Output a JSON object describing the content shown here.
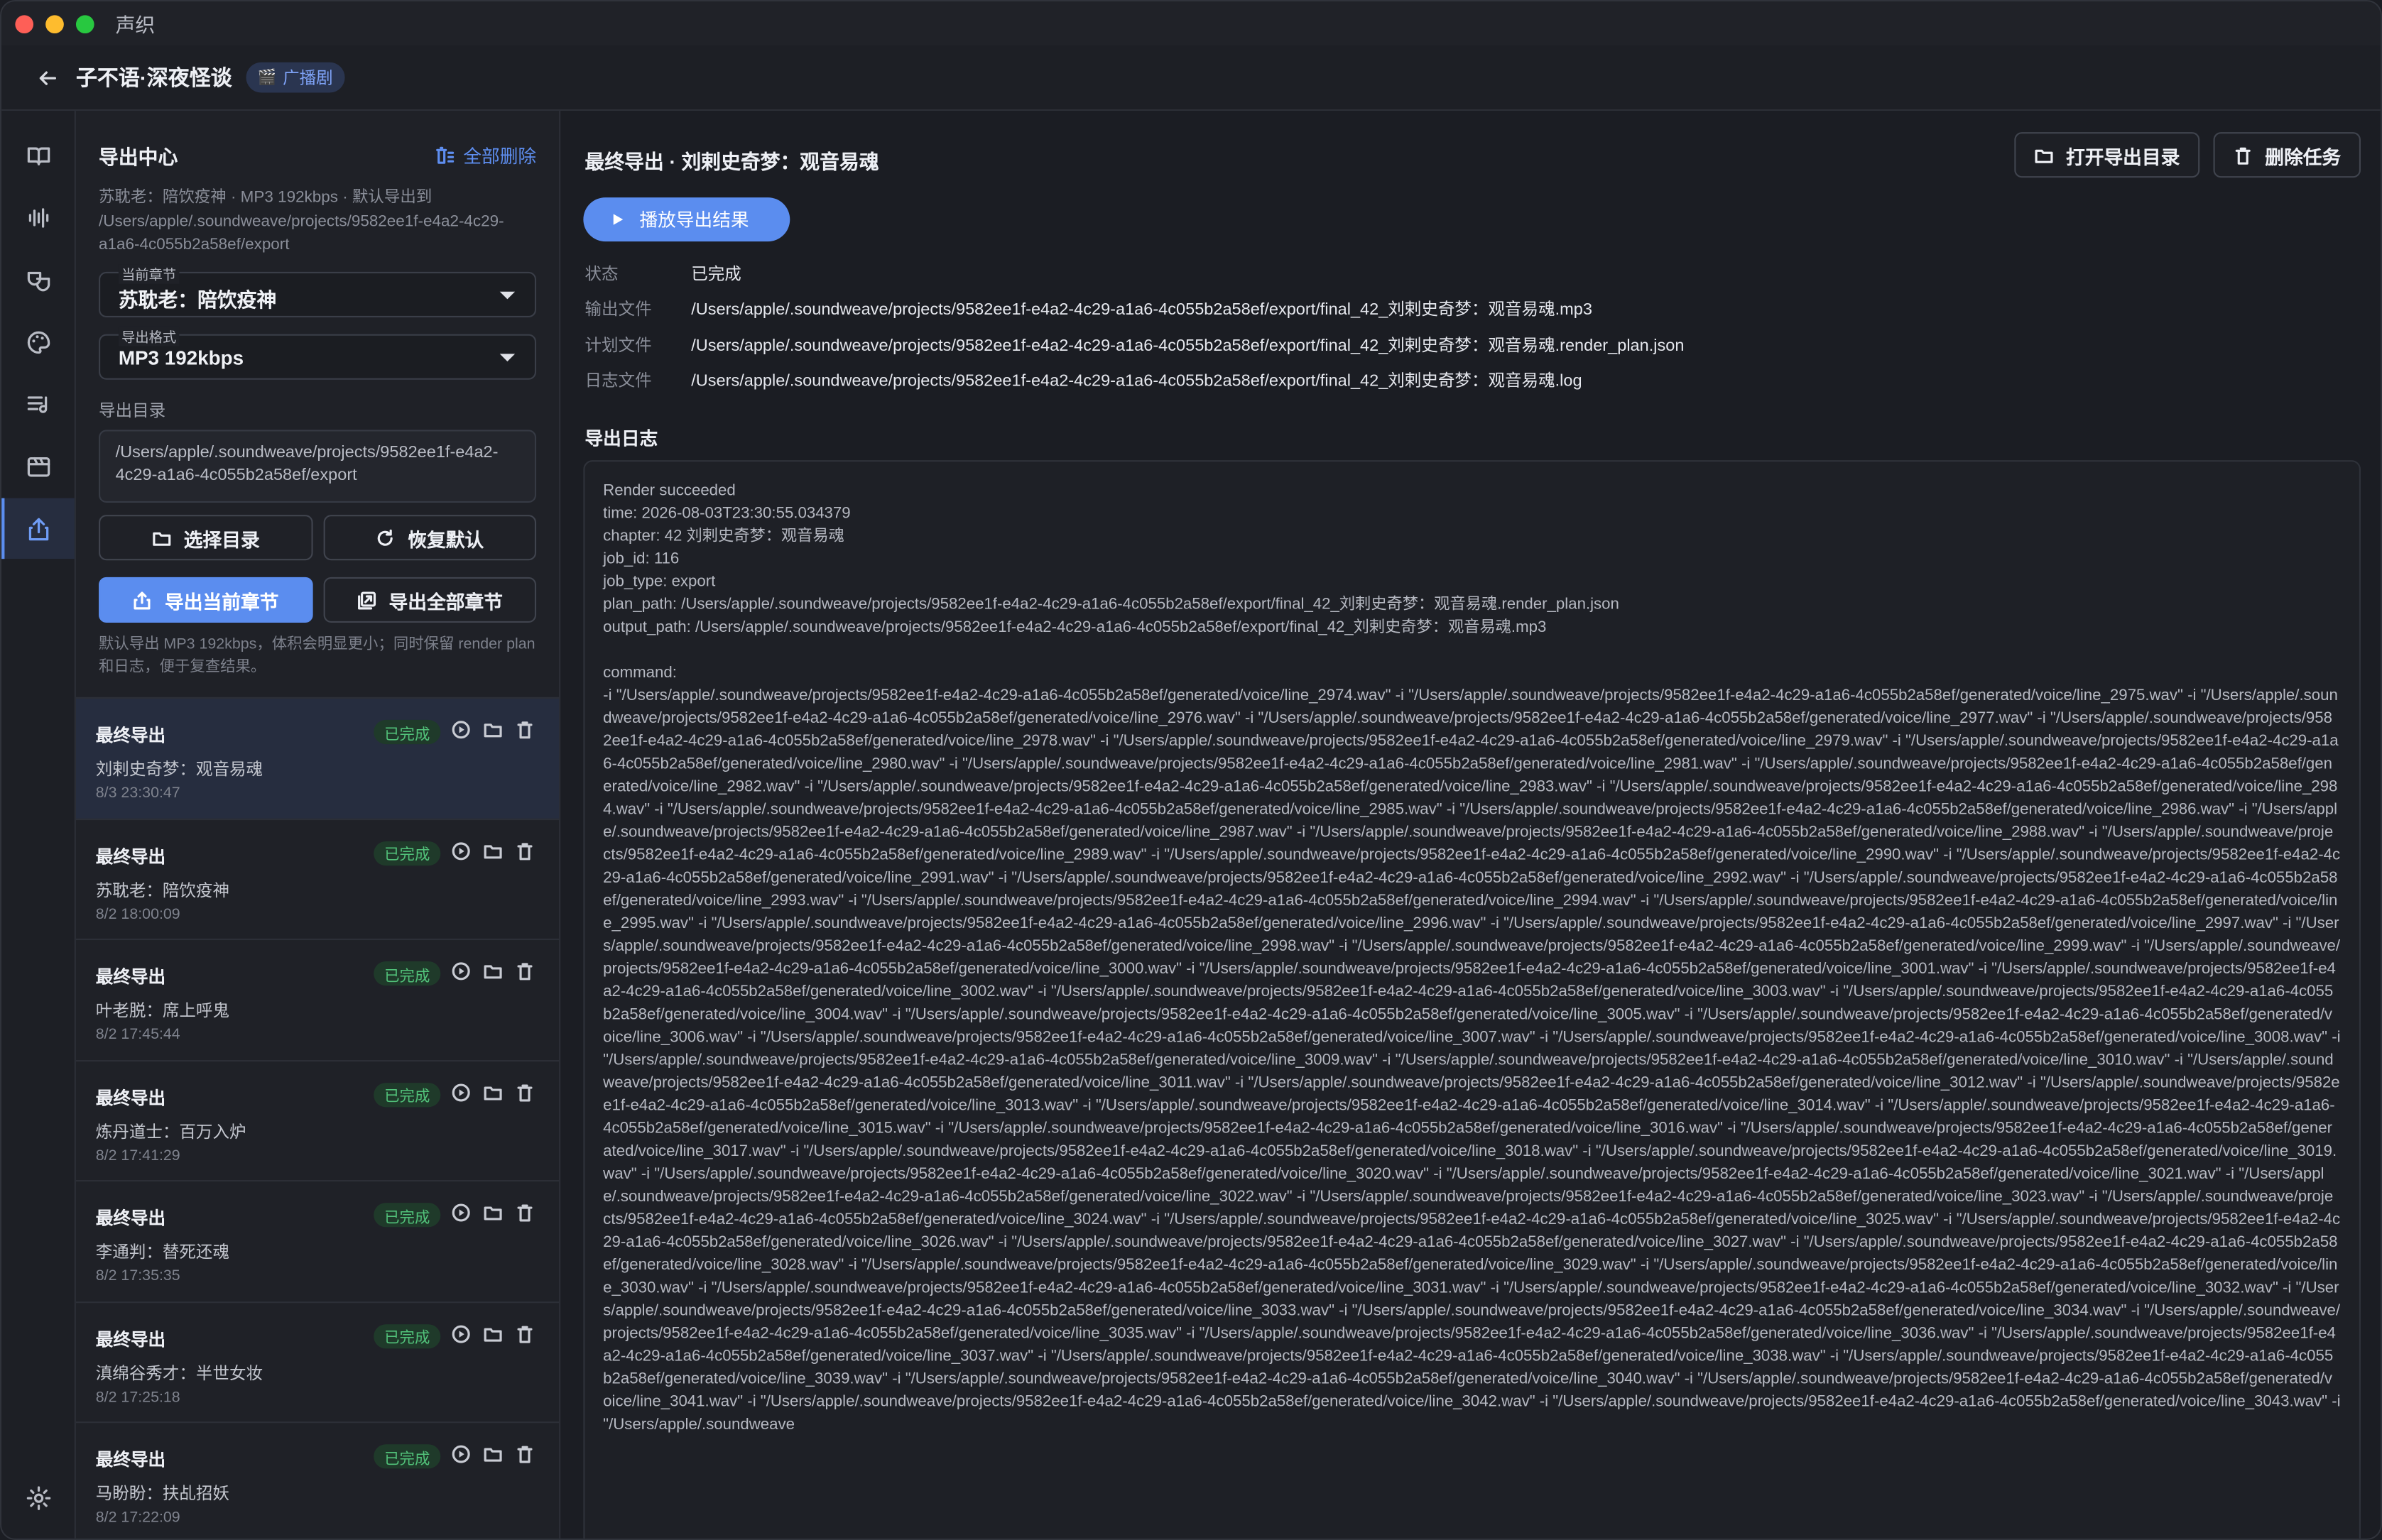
{
  "window": {
    "app_name": "声织"
  },
  "header": {
    "project_title": "子不语·深夜怪谈",
    "badge": "广播剧"
  },
  "rail": {
    "items": [
      {
        "name": "book-icon",
        "active": false
      },
      {
        "name": "waveform-icon",
        "active": false
      },
      {
        "name": "masks-icon",
        "active": false
      },
      {
        "name": "palette-icon",
        "active": false
      },
      {
        "name": "playlist-icon",
        "active": false
      },
      {
        "name": "film-icon",
        "active": false
      },
      {
        "name": "export-icon",
        "active": true
      }
    ],
    "settings": "gear-icon"
  },
  "export_panel": {
    "title": "导出中心",
    "delete_all": "全部删除",
    "description": "苏耽老：陪饮疫神 · MP3 192kbps · 默认导出到 /Users/apple/.soundweave/projects/9582ee1f-e4a2-4c29-a1a6-4c055b2a58ef/export",
    "chapter_label": "当前章节",
    "chapter_value": "苏耽老：陪饮疫神",
    "format_label": "导出格式",
    "format_value": "MP3 192kbps",
    "dir_label": "导出目录",
    "dir_value": "/Users/apple/.soundweave/projects/9582ee1f-e4a2-4c29-a1a6-4c055b2a58ef/export",
    "choose_dir": "选择目录",
    "restore_default": "恢复默认",
    "export_current": "导出当前章节",
    "export_all": "导出全部章节",
    "hint": "默认导出 MP3 192kbps，体积会明显更小；同时保留 render plan 和日志，便于复查结果。"
  },
  "tasks": [
    {
      "title": "最终导出",
      "chapter": "刘剌史奇梦：观音易魂",
      "time": "8/3 23:30:47",
      "status": "已完成",
      "active": true
    },
    {
      "title": "最终导出",
      "chapter": "苏耽老：陪饮疫神",
      "time": "8/2 18:00:09",
      "status": "已完成",
      "active": false
    },
    {
      "title": "最终导出",
      "chapter": "叶老脱：席上呼鬼",
      "time": "8/2 17:45:44",
      "status": "已完成",
      "active": false
    },
    {
      "title": "最终导出",
      "chapter": "炼丹道士：百万入炉",
      "time": "8/2 17:41:29",
      "status": "已完成",
      "active": false
    },
    {
      "title": "最终导出",
      "chapter": "李通判：替死还魂",
      "time": "8/2 17:35:35",
      "status": "已完成",
      "active": false
    },
    {
      "title": "最终导出",
      "chapter": "滇绵谷秀才：半世女妆",
      "time": "8/2 17:25:18",
      "status": "已完成",
      "active": false
    },
    {
      "title": "最终导出",
      "chapter": "马盼盼：扶乩招妖",
      "time": "8/2 17:22:09",
      "status": "已完成",
      "active": false
    }
  ],
  "detail": {
    "title": "最终导出 · 刘剌史奇梦：观音易魂",
    "open_dir": "打开导出目录",
    "delete_task": "删除任务",
    "play": "播放导出结果",
    "fields": [
      {
        "key": "状态",
        "value": "已完成"
      },
      {
        "key": "输出文件",
        "value": "/Users/apple/.soundweave/projects/9582ee1f-e4a2-4c29-a1a6-4c055b2a58ef/export/final_42_刘剌史奇梦：观音易魂.mp3"
      },
      {
        "key": "计划文件",
        "value": "/Users/apple/.soundweave/projects/9582ee1f-e4a2-4c29-a1a6-4c055b2a58ef/export/final_42_刘剌史奇梦：观音易魂.render_plan.json"
      },
      {
        "key": "日志文件",
        "value": "/Users/apple/.soundweave/projects/9582ee1f-e4a2-4c29-a1a6-4c055b2a58ef/export/final_42_刘剌史奇梦：观音易魂.log"
      }
    ],
    "log_title": "导出日志",
    "log_text": "Render succeeded\ntime: 2026-08-03T23:30:55.034379\nchapter: 42 刘剌史奇梦：观音易魂\njob_id: 116\njob_type: export\nplan_path: /Users/apple/.soundweave/projects/9582ee1f-e4a2-4c29-a1a6-4c055b2a58ef/export/final_42_刘剌史奇梦：观音易魂.render_plan.json\noutput_path: /Users/apple/.soundweave/projects/9582ee1f-e4a2-4c29-a1a6-4c055b2a58ef/export/final_42_刘剌史奇梦：观音易魂.mp3\n\ncommand:\n-i \"/Users/apple/.soundweave/projects/9582ee1f-e4a2-4c29-a1a6-4c055b2a58ef/generated/voice/line_2974.wav\" -i \"/Users/apple/.soundweave/projects/9582ee1f-e4a2-4c29-a1a6-4c055b2a58ef/generated/voice/line_2975.wav\" -i \"/Users/apple/.soundweave/projects/9582ee1f-e4a2-4c29-a1a6-4c055b2a58ef/generated/voice/line_2976.wav\" -i \"/Users/apple/.soundweave/projects/9582ee1f-e4a2-4c29-a1a6-4c055b2a58ef/generated/voice/line_2977.wav\" -i \"/Users/apple/.soundweave/projects/9582ee1f-e4a2-4c29-a1a6-4c055b2a58ef/generated/voice/line_2978.wav\" -i \"/Users/apple/.soundweave/projects/9582ee1f-e4a2-4c29-a1a6-4c055b2a58ef/generated/voice/line_2979.wav\" -i \"/Users/apple/.soundweave/projects/9582ee1f-e4a2-4c29-a1a6-4c055b2a58ef/generated/voice/line_2980.wav\" -i \"/Users/apple/.soundweave/projects/9582ee1f-e4a2-4c29-a1a6-4c055b2a58ef/generated/voice/line_2981.wav\" -i \"/Users/apple/.soundweave/projects/9582ee1f-e4a2-4c29-a1a6-4c055b2a58ef/generated/voice/line_2982.wav\" -i \"/Users/apple/.soundweave/projects/9582ee1f-e4a2-4c29-a1a6-4c055b2a58ef/generated/voice/line_2983.wav\" -i \"/Users/apple/.soundweave/projects/9582ee1f-e4a2-4c29-a1a6-4c055b2a58ef/generated/voice/line_2984.wav\" -i \"/Users/apple/.soundweave/projects/9582ee1f-e4a2-4c29-a1a6-4c055b2a58ef/generated/voice/line_2985.wav\" -i \"/Users/apple/.soundweave/projects/9582ee1f-e4a2-4c29-a1a6-4c055b2a58ef/generated/voice/line_2986.wav\" -i \"/Users/apple/.soundweave/projects/9582ee1f-e4a2-4c29-a1a6-4c055b2a58ef/generated/voice/line_2987.wav\" -i \"/Users/apple/.soundweave/projects/9582ee1f-e4a2-4c29-a1a6-4c055b2a58ef/generated/voice/line_2988.wav\" -i \"/Users/apple/.soundweave/projects/9582ee1f-e4a2-4c29-a1a6-4c055b2a58ef/generated/voice/line_2989.wav\" -i \"/Users/apple/.soundweave/projects/9582ee1f-e4a2-4c29-a1a6-4c055b2a58ef/generated/voice/line_2990.wav\" -i \"/Users/apple/.soundweave/projects/9582ee1f-e4a2-4c29-a1a6-4c055b2a58ef/generated/voice/line_2991.wav\" -i \"/Users/apple/.soundweave/projects/9582ee1f-e4a2-4c29-a1a6-4c055b2a58ef/generated/voice/line_2992.wav\" -i \"/Users/apple/.soundweave/projects/9582ee1f-e4a2-4c29-a1a6-4c055b2a58ef/generated/voice/line_2993.wav\" -i \"/Users/apple/.soundweave/projects/9582ee1f-e4a2-4c29-a1a6-4c055b2a58ef/generated/voice/line_2994.wav\" -i \"/Users/apple/.soundweave/projects/9582ee1f-e4a2-4c29-a1a6-4c055b2a58ef/generated/voice/line_2995.wav\" -i \"/Users/apple/.soundweave/projects/9582ee1f-e4a2-4c29-a1a6-4c055b2a58ef/generated/voice/line_2996.wav\" -i \"/Users/apple/.soundweave/projects/9582ee1f-e4a2-4c29-a1a6-4c055b2a58ef/generated/voice/line_2997.wav\" -i \"/Users/apple/.soundweave/projects/9582ee1f-e4a2-4c29-a1a6-4c055b2a58ef/generated/voice/line_2998.wav\" -i \"/Users/apple/.soundweave/projects/9582ee1f-e4a2-4c29-a1a6-4c055b2a58ef/generated/voice/line_2999.wav\" -i \"/Users/apple/.soundweave/projects/9582ee1f-e4a2-4c29-a1a6-4c055b2a58ef/generated/voice/line_3000.wav\" -i \"/Users/apple/.soundweave/projects/9582ee1f-e4a2-4c29-a1a6-4c055b2a58ef/generated/voice/line_3001.wav\" -i \"/Users/apple/.soundweave/projects/9582ee1f-e4a2-4c29-a1a6-4c055b2a58ef/generated/voice/line_3002.wav\" -i \"/Users/apple/.soundweave/projects/9582ee1f-e4a2-4c29-a1a6-4c055b2a58ef/generated/voice/line_3003.wav\" -i \"/Users/apple/.soundweave/projects/9582ee1f-e4a2-4c29-a1a6-4c055b2a58ef/generated/voice/line_3004.wav\" -i \"/Users/apple/.soundweave/projects/9582ee1f-e4a2-4c29-a1a6-4c055b2a58ef/generated/voice/line_3005.wav\" -i \"/Users/apple/.soundweave/projects/9582ee1f-e4a2-4c29-a1a6-4c055b2a58ef/generated/voice/line_3006.wav\" -i \"/Users/apple/.soundweave/projects/9582ee1f-e4a2-4c29-a1a6-4c055b2a58ef/generated/voice/line_3007.wav\" -i \"/Users/apple/.soundweave/projects/9582ee1f-e4a2-4c29-a1a6-4c055b2a58ef/generated/voice/line_3008.wav\" -i \"/Users/apple/.soundweave/projects/9582ee1f-e4a2-4c29-a1a6-4c055b2a58ef/generated/voice/line_3009.wav\" -i \"/Users/apple/.soundweave/projects/9582ee1f-e4a2-4c29-a1a6-4c055b2a58ef/generated/voice/line_3010.wav\" -i \"/Users/apple/.soundweave/projects/9582ee1f-e4a2-4c29-a1a6-4c055b2a58ef/generated/voice/line_3011.wav\" -i \"/Users/apple/.soundweave/projects/9582ee1f-e4a2-4c29-a1a6-4c055b2a58ef/generated/voice/line_3012.wav\" -i \"/Users/apple/.soundweave/projects/9582ee1f-e4a2-4c29-a1a6-4c055b2a58ef/generated/voice/line_3013.wav\" -i \"/Users/apple/.soundweave/projects/9582ee1f-e4a2-4c29-a1a6-4c055b2a58ef/generated/voice/line_3014.wav\" -i \"/Users/apple/.soundweave/projects/9582ee1f-e4a2-4c29-a1a6-4c055b2a58ef/generated/voice/line_3015.wav\" -i \"/Users/apple/.soundweave/projects/9582ee1f-e4a2-4c29-a1a6-4c055b2a58ef/generated/voice/line_3016.wav\" -i \"/Users/apple/.soundweave/projects/9582ee1f-e4a2-4c29-a1a6-4c055b2a58ef/generated/voice/line_3017.wav\" -i \"/Users/apple/.soundweave/projects/9582ee1f-e4a2-4c29-a1a6-4c055b2a58ef/generated/voice/line_3018.wav\" -i \"/Users/apple/.soundweave/projects/9582ee1f-e4a2-4c29-a1a6-4c055b2a58ef/generated/voice/line_3019.wav\" -i \"/Users/apple/.soundweave/projects/9582ee1f-e4a2-4c29-a1a6-4c055b2a58ef/generated/voice/line_3020.wav\" -i \"/Users/apple/.soundweave/projects/9582ee1f-e4a2-4c29-a1a6-4c055b2a58ef/generated/voice/line_3021.wav\" -i \"/Users/apple/.soundweave/projects/9582ee1f-e4a2-4c29-a1a6-4c055b2a58ef/generated/voice/line_3022.wav\" -i \"/Users/apple/.soundweave/projects/9582ee1f-e4a2-4c29-a1a6-4c055b2a58ef/generated/voice/line_3023.wav\" -i \"/Users/apple/.soundweave/projects/9582ee1f-e4a2-4c29-a1a6-4c055b2a58ef/generated/voice/line_3024.wav\" -i \"/Users/apple/.soundweave/projects/9582ee1f-e4a2-4c29-a1a6-4c055b2a58ef/generated/voice/line_3025.wav\" -i \"/Users/apple/.soundweave/projects/9582ee1f-e4a2-4c29-a1a6-4c055b2a58ef/generated/voice/line_3026.wav\" -i \"/Users/apple/.soundweave/projects/9582ee1f-e4a2-4c29-a1a6-4c055b2a58ef/generated/voice/line_3027.wav\" -i \"/Users/apple/.soundweave/projects/9582ee1f-e4a2-4c29-a1a6-4c055b2a58ef/generated/voice/line_3028.wav\" -i \"/Users/apple/.soundweave/projects/9582ee1f-e4a2-4c29-a1a6-4c055b2a58ef/generated/voice/line_3029.wav\" -i \"/Users/apple/.soundweave/projects/9582ee1f-e4a2-4c29-a1a6-4c055b2a58ef/generated/voice/line_3030.wav\" -i \"/Users/apple/.soundweave/projects/9582ee1f-e4a2-4c29-a1a6-4c055b2a58ef/generated/voice/line_3031.wav\" -i \"/Users/apple/.soundweave/projects/9582ee1f-e4a2-4c29-a1a6-4c055b2a58ef/generated/voice/line_3032.wav\" -i \"/Users/apple/.soundweave/projects/9582ee1f-e4a2-4c29-a1a6-4c055b2a58ef/generated/voice/line_3033.wav\" -i \"/Users/apple/.soundweave/projects/9582ee1f-e4a2-4c29-a1a6-4c055b2a58ef/generated/voice/line_3034.wav\" -i \"/Users/apple/.soundweave/projects/9582ee1f-e4a2-4c29-a1a6-4c055b2a58ef/generated/voice/line_3035.wav\" -i \"/Users/apple/.soundweave/projects/9582ee1f-e4a2-4c29-a1a6-4c055b2a58ef/generated/voice/line_3036.wav\" -i \"/Users/apple/.soundweave/projects/9582ee1f-e4a2-4c29-a1a6-4c055b2a58ef/generated/voice/line_3037.wav\" -i \"/Users/apple/.soundweave/projects/9582ee1f-e4a2-4c29-a1a6-4c055b2a58ef/generated/voice/line_3038.wav\" -i \"/Users/apple/.soundweave/projects/9582ee1f-e4a2-4c29-a1a6-4c055b2a58ef/generated/voice/line_3039.wav\" -i \"/Users/apple/.soundweave/projects/9582ee1f-e4a2-4c29-a1a6-4c055b2a58ef/generated/voice/line_3040.wav\" -i \"/Users/apple/.soundweave/projects/9582ee1f-e4a2-4c29-a1a6-4c055b2a58ef/generated/voice/line_3041.wav\" -i \"/Users/apple/.soundweave/projects/9582ee1f-e4a2-4c29-a1a6-4c055b2a58ef/generated/voice/line_3042.wav\" -i \"/Users/apple/.soundweave/projects/9582ee1f-e4a2-4c29-a1a6-4c055b2a58ef/generated/voice/line_3043.wav\" -i \"/Users/apple/.soundweave"
  },
  "colors": {
    "accent": "#5b8def",
    "success": "#52c27a",
    "background": "#1b1d23"
  }
}
